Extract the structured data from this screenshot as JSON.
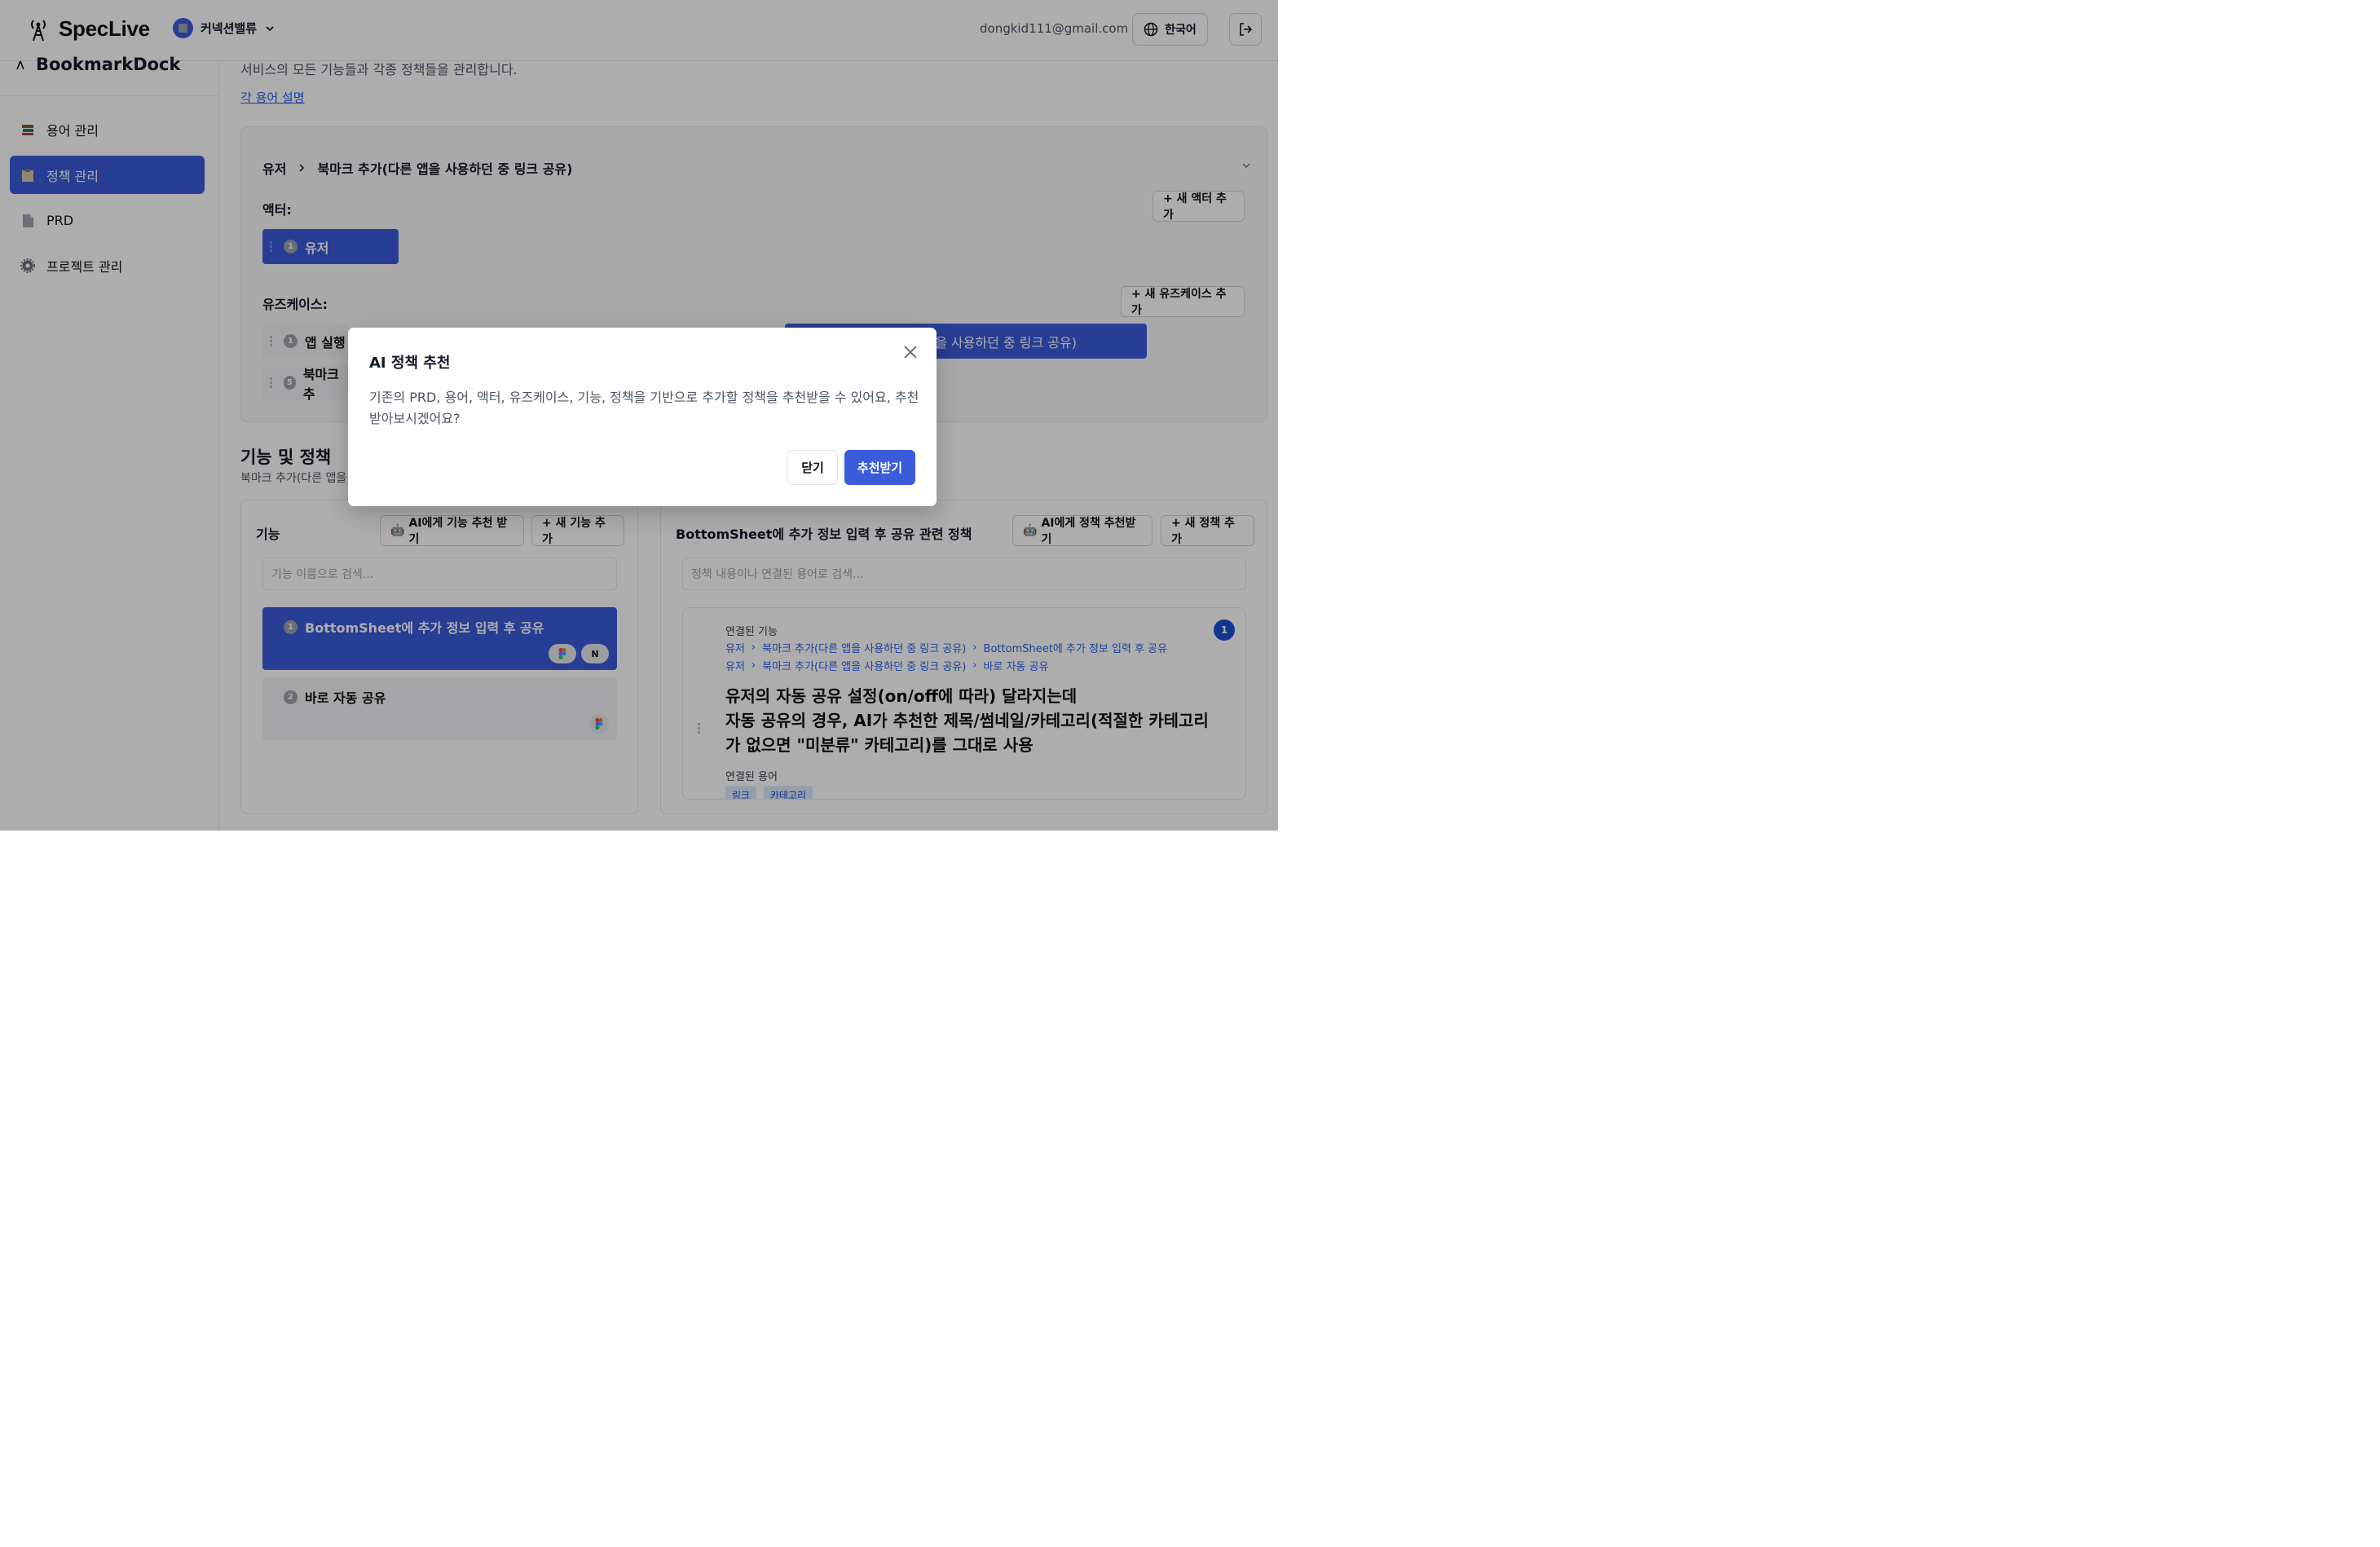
{
  "header": {
    "brand": "SpecLive",
    "workspace": "커넥션밸류",
    "email": "dongkid111@gmail.com",
    "language": "한국어"
  },
  "sidebar": {
    "project": "BookmarkDock",
    "items": [
      {
        "label": "용어 관리",
        "icon": "books-icon"
      },
      {
        "label": "정책 관리",
        "icon": "clipboard-icon",
        "active": true
      },
      {
        "label": "PRD",
        "icon": "document-icon"
      },
      {
        "label": "프로젝트 관리",
        "icon": "gear-icon"
      }
    ]
  },
  "main": {
    "description": "서비스의 모든 기능들과 각종 정책들을 관리합니다.",
    "terms_link": "각 용어 설명",
    "breadcrumb": [
      "유저",
      "북마크 추가(다른 앱을 사용하던 중 링크 공유)"
    ],
    "actors_label": "액터:",
    "add_actor": "+ 새 액터 추가",
    "actors": [
      {
        "num": "1",
        "label": "유저"
      }
    ],
    "usecases_label": "유즈케이스:",
    "add_usecase": "+ 새 유즈케이스 추가",
    "usecases": [
      {
        "num": "1",
        "label": "앱 실행"
      },
      {
        "num": "5",
        "label": "북마크 추"
      }
    ],
    "usecase_selected_tail": "을 사용하던 중 링크 공유)",
    "section_title": "기능 및 정책",
    "section_sub": "북마크 추가(다른 앱을"
  },
  "features": {
    "title": "기능",
    "ai_button": "AI에게 기능 추천 받기",
    "add_button": "+ 새 기능 추가",
    "search_placeholder": "기능 이름으로 검색...",
    "items": [
      {
        "num": "1",
        "label": "BottomSheet에 추가 정보 입력 후 공유"
      },
      {
        "num": "2",
        "label": "바로 자동 공유"
      }
    ]
  },
  "policies": {
    "title": "BottomSheet에 추가 정보 입력 후 공유 관련 정책",
    "ai_button": "AI에게 정책 추천받기",
    "add_button": "+ 새 정책 추가",
    "search_placeholder": "정책 내용이나 연결된 용어로 검색...",
    "linked_features_label": "연결된 기능",
    "paths": [
      [
        "유저",
        "북마크 추가(다른 앱을 사용하던 중 링크 공유)",
        "BottomSheet에 추가 정보 입력 후 공유"
      ],
      [
        "유저",
        "북마크 추가(다른 앱을 사용하던 중 링크 공유)",
        "바로 자동 공유"
      ]
    ],
    "policy_lines": [
      "유저의 자동 공유 설정(on/off에 따라) 달라지는데",
      "자동 공유의 경우, AI가 추천한 제목/썸네일/카테고리(적절한 카테고리",
      "가 없으면 \"미분류\" 카테고리)를 그대로 사용"
    ],
    "count_badge": "1",
    "linked_terms_label": "연결된 용어",
    "terms": [
      "링크",
      "카테고리"
    ]
  },
  "modal": {
    "title": "AI 정책 추천",
    "body": "기존의 PRD, 용어, 액터, 유즈케이스, 기능, 정책을 기반으로 추가할 정책을 추천받을 수 있어요, 추천받아보시겠어요?",
    "close_label": "닫기",
    "confirm_label": "추천받기"
  },
  "colors": {
    "primary": "#3b5bdb",
    "link": "#2563eb"
  }
}
